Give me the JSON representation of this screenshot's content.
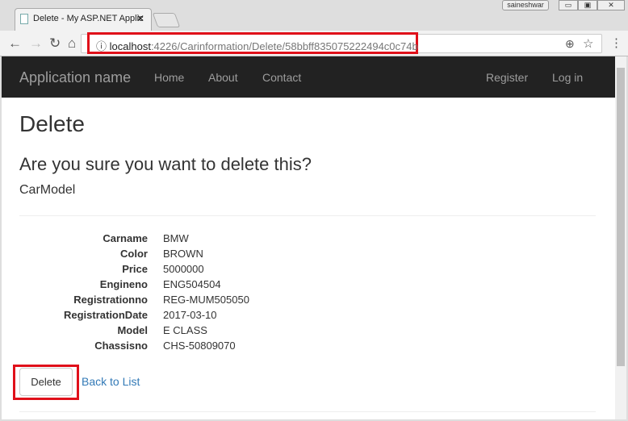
{
  "browser": {
    "tab_title": "Delete - My ASP.NET Applic",
    "user": "saineshwar",
    "url_host": "localhost",
    "url_path": ":4226/Carinformation/Delete/58bbff835075222494c0c74b"
  },
  "navbar": {
    "brand": "Application name",
    "links": [
      "Home",
      "About",
      "Contact"
    ],
    "right": [
      "Register",
      "Log in"
    ]
  },
  "page": {
    "title": "Delete",
    "question": "Are you sure you want to delete this?",
    "model": "CarModel",
    "fields": [
      {
        "label": "Carname",
        "value": "BMW"
      },
      {
        "label": "Color",
        "value": "BROWN"
      },
      {
        "label": "Price",
        "value": "5000000"
      },
      {
        "label": "Engineno",
        "value": "ENG504504"
      },
      {
        "label": "Registrationno",
        "value": "REG-MUM505050"
      },
      {
        "label": "RegistrationDate",
        "value": "2017-03-10"
      },
      {
        "label": "Model",
        "value": "E CLASS"
      },
      {
        "label": "Chassisno",
        "value": "CHS-50809070"
      }
    ],
    "delete_label": "Delete",
    "back_label": "Back to List"
  },
  "colors": {
    "highlight": "#e0101a",
    "navbar": "#222222",
    "link": "#337ab7"
  }
}
